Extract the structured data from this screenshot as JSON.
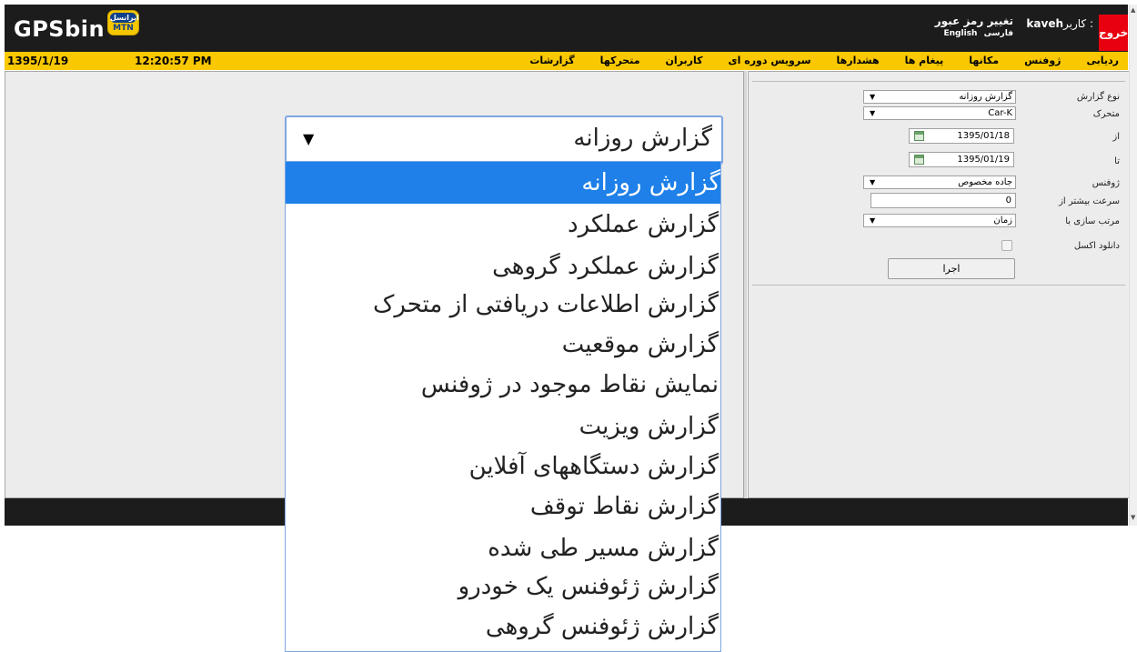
{
  "header": {
    "logo": "GPSbin",
    "mtn_top": "ایرانسل",
    "mtn_bottom": "MTN",
    "exit": "خروج",
    "user_label": "کاربر :",
    "user_name": "kaveh",
    "change_password": "تغییر رمز عبور",
    "lang_english": "English",
    "lang_farsi": "فارسی"
  },
  "menubar": {
    "date": "1395/1/19",
    "time": "12:20:57 PM",
    "items": [
      "ردیابی",
      "ژوفنس",
      "مکانها",
      "پیغام ها",
      "هشدارها",
      "سرویس دوره ای",
      "کاربران",
      "متحرکها",
      "گزارشات"
    ]
  },
  "form": {
    "report_type_label": "نوع گزارش",
    "report_type_value": "گزارش روزانه",
    "vehicle_label": "متحرک",
    "vehicle_value": "Car-K",
    "from_label": "از",
    "from_value": "1395/01/18",
    "to_label": "تا",
    "to_value": "1395/01/19",
    "geofence_label": "ژوفنس",
    "geofence_value": "جاده مخصوص",
    "speed_label": "سرعت بیشتر از",
    "speed_value": "0",
    "sort_label": "مرتب سازی با",
    "sort_value": "زمان",
    "excel_label": "دانلود اکسل",
    "run_button": "اجرا"
  },
  "dropdown": {
    "selected": "گزارش روزانه",
    "options": [
      "گزارش روزانه",
      "گزارش عملکرد",
      "گزارش عملکرد گروهی",
      "گزارش اطلاعات دریافتی از متحرک",
      "گزارش موقعیت",
      "نمایش نقاط موجود در ژوفنس",
      "گزارش ویزیت",
      "گزارش دستگاههای آفلاین",
      "گزارش نقاط توقف",
      "گزارش مسیر طی شده",
      "گزارش ژئوفنس یک خودرو",
      "گزارش ژئوفنس گروهی"
    ],
    "selected_index": 0
  }
}
